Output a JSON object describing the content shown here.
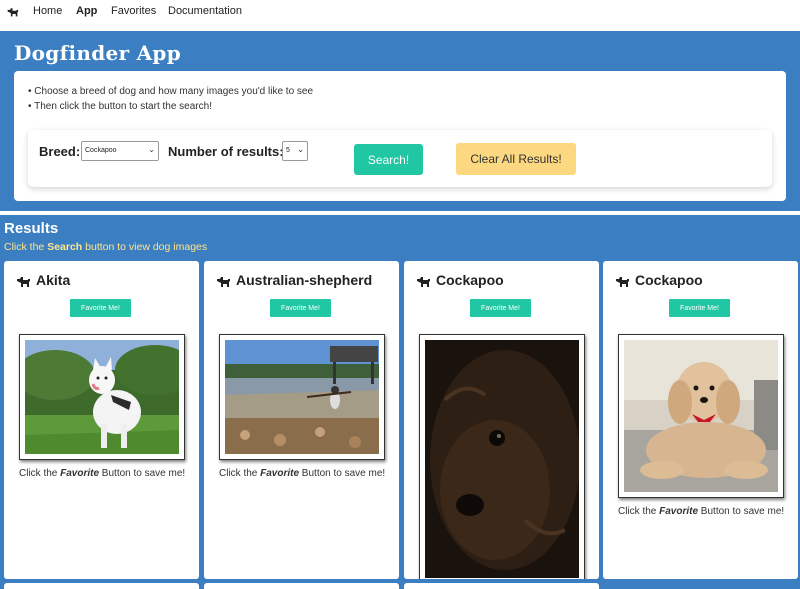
{
  "nav": {
    "home": "Home",
    "app": "App",
    "favorites": "Favorites",
    "documentation": "Documentation",
    "logo_icon": "dog-icon"
  },
  "header": {
    "title": "Dogfinder App",
    "instruction_1": "• Choose a breed of dog and how many images you'd like to see",
    "instruction_2": "• Then click the button to start the search!"
  },
  "form": {
    "breed_label": "Breed:",
    "breed_value": "Cockapoo",
    "count_label": "Number of results:",
    "count_value": "5",
    "search_label": "Search!",
    "clear_label": "Clear All Results!"
  },
  "results": {
    "title": "Results",
    "hint_prefix": "Click the ",
    "hint_bold": "Search",
    "hint_suffix": " button to view dog images"
  },
  "cards": [
    {
      "title": "Akita",
      "button": "Favorite Me!",
      "caption_prefix": "Click the ",
      "caption_bold": "Favorite",
      "caption_suffix": " Button to save me!"
    },
    {
      "title": "Australian-shepherd",
      "button": "Favorite Me!",
      "caption_prefix": "Click the ",
      "caption_bold": "Favorite",
      "caption_suffix": " Button to save me!"
    },
    {
      "title": "Cockapoo",
      "button": "Favorite Me!"
    },
    {
      "title": "Cockapoo",
      "button": "Favorite Me!",
      "caption_prefix": "Click the ",
      "caption_bold": "Favorite",
      "caption_suffix": " Button to save me!"
    }
  ],
  "colors": {
    "primary_blue": "#3b7fc2",
    "teal": "#21c6a3",
    "yellow": "#fcd881"
  }
}
